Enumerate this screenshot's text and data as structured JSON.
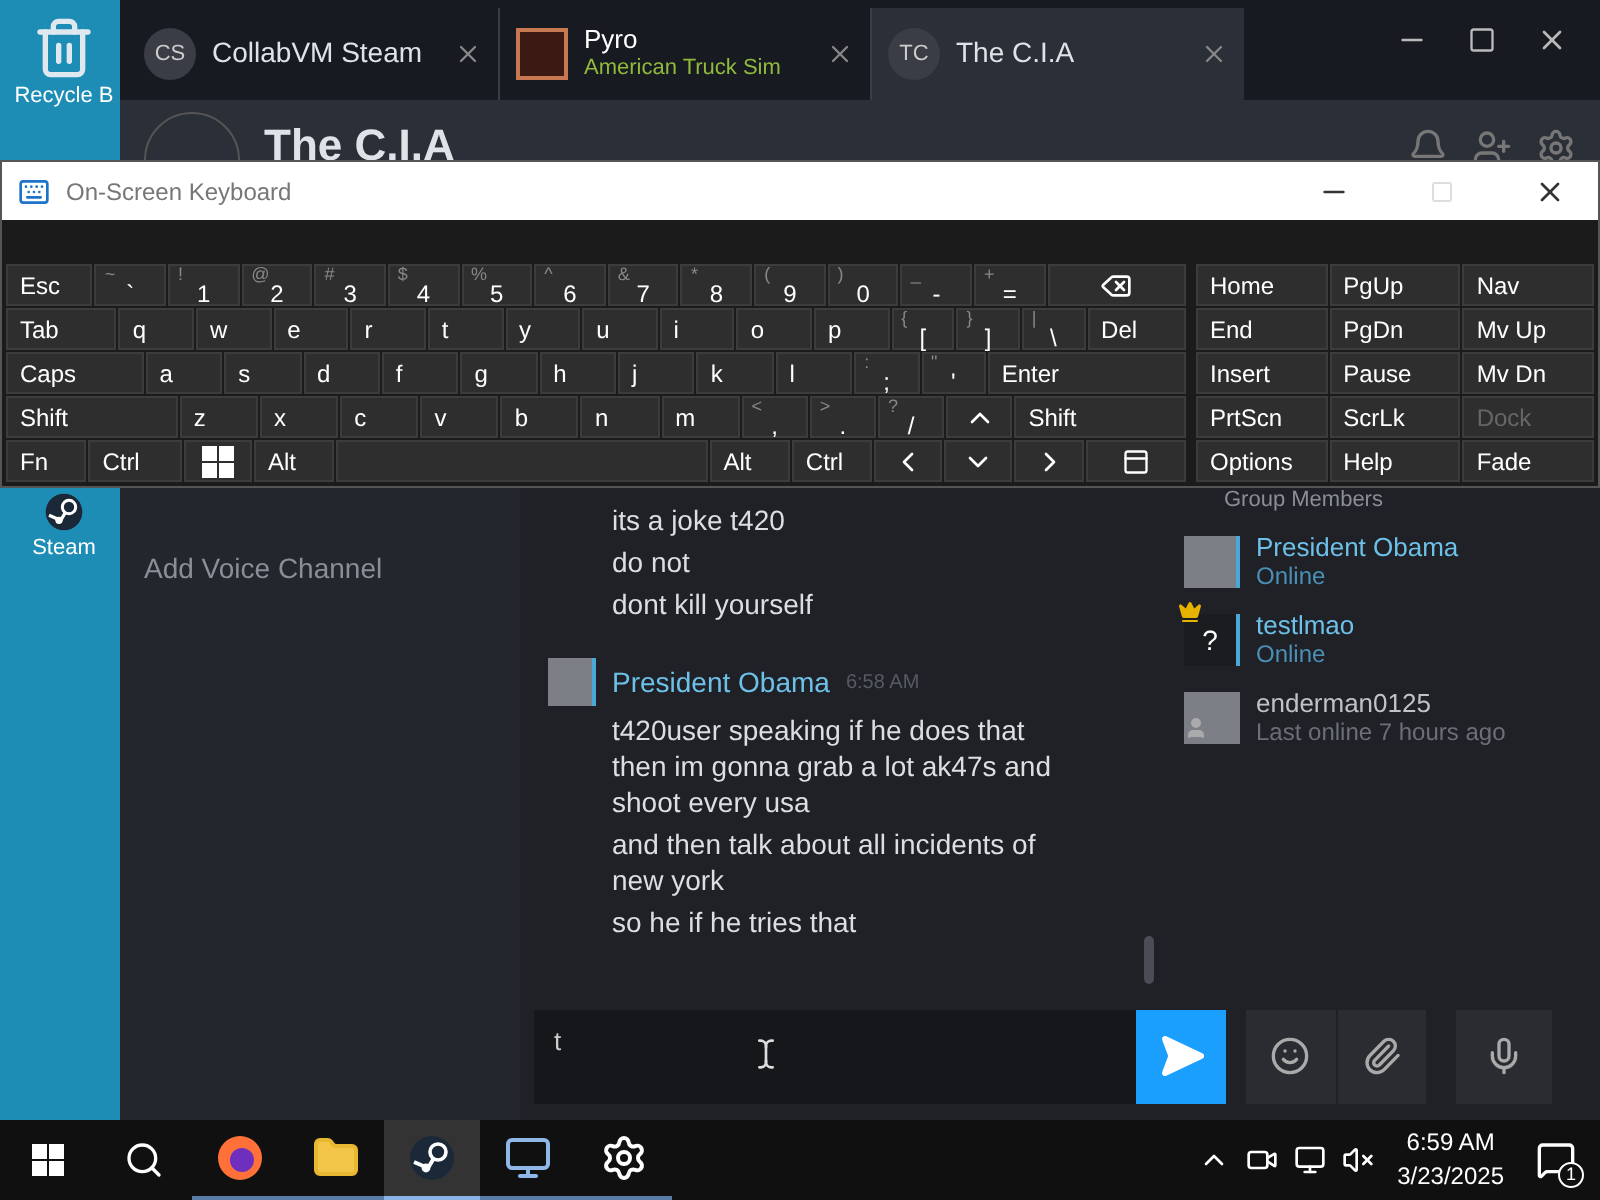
{
  "desktop_icons": [
    {
      "kind": "recycle",
      "label": "Recycle B"
    },
    {
      "kind": "steam",
      "label": "Steam"
    }
  ],
  "steam": {
    "tabs": [
      {
        "kind": "initials",
        "avatar": "CS",
        "title": "CollabVM Steam",
        "selected": false
      },
      {
        "kind": "game",
        "title": "Pyro",
        "subtitle": "American Truck Sim",
        "selected": false
      },
      {
        "kind": "initials",
        "avatar": "TC",
        "title": "The C.I.A",
        "selected": true
      }
    ],
    "group": {
      "name": "The C.I.A"
    },
    "sidebar": {
      "add_voice": "Add Voice Channel"
    },
    "chat": {
      "groups": [
        {
          "messages": [
            "its a joke t420",
            "do not",
            "dont kill yourself"
          ]
        },
        {
          "author": "President Obama",
          "time": "6:58 AM",
          "messages": [
            "t420user speaking if he does that then im gonna grab a lot ak47s and shoot every usa",
            "and then talk about all incidents of new york",
            "so he if he tries that"
          ]
        }
      ]
    },
    "members": {
      "title": "Group Members",
      "list": [
        {
          "name": "President Obama",
          "status": "Online",
          "online": true,
          "owner": false,
          "kind": "photo"
        },
        {
          "name": "testlmao",
          "status": "Online",
          "online": true,
          "owner": true,
          "kind": "unknown",
          "avatar_text": "?"
        },
        {
          "name": "enderman0125",
          "status": "Last online 7 hours ago",
          "online": false,
          "owner": false,
          "kind": "photo"
        }
      ]
    },
    "input": {
      "value": "t"
    }
  },
  "osk": {
    "title": "On-Screen Keyboard",
    "rows": [
      {
        "keys": [
          {
            "kind": "key",
            "label": "Esc"
          },
          {
            "kind": "key",
            "label": "`",
            "shift": "~"
          },
          {
            "kind": "key",
            "label": "1",
            "shift": "!"
          },
          {
            "kind": "key",
            "label": "2",
            "shift": "@"
          },
          {
            "kind": "key",
            "label": "3",
            "shift": "#"
          },
          {
            "kind": "key",
            "label": "4",
            "shift": "$"
          },
          {
            "kind": "key",
            "label": "5",
            "shift": "%"
          },
          {
            "kind": "key",
            "label": "6",
            "shift": "^"
          },
          {
            "kind": "key",
            "label": "7",
            "shift": "&"
          },
          {
            "kind": "key",
            "label": "8",
            "shift": "*"
          },
          {
            "kind": "key",
            "label": "9",
            "shift": "("
          },
          {
            "kind": "key",
            "label": "0",
            "shift": ")"
          },
          {
            "kind": "key",
            "label": "-",
            "shift": "_"
          },
          {
            "kind": "key",
            "label": "=",
            "shift": "+"
          },
          {
            "kind": "backspace"
          }
        ]
      },
      {
        "keys": [
          {
            "kind": "key",
            "label": "Tab"
          },
          {
            "kind": "key",
            "label": "q"
          },
          {
            "kind": "key",
            "label": "w"
          },
          {
            "kind": "key",
            "label": "e"
          },
          {
            "kind": "key",
            "label": "r"
          },
          {
            "kind": "key",
            "label": "t"
          },
          {
            "kind": "key",
            "label": "y"
          },
          {
            "kind": "key",
            "label": "u"
          },
          {
            "kind": "key",
            "label": "i"
          },
          {
            "kind": "key",
            "label": "o"
          },
          {
            "kind": "key",
            "label": "p"
          },
          {
            "kind": "key",
            "label": "[",
            "shift": "{"
          },
          {
            "kind": "key",
            "label": "]",
            "shift": "}"
          },
          {
            "kind": "key",
            "label": "\\",
            "shift": "|"
          },
          {
            "kind": "key",
            "label": "Del"
          }
        ]
      },
      {
        "keys": [
          {
            "kind": "key",
            "label": "Caps"
          },
          {
            "kind": "key",
            "label": "a"
          },
          {
            "kind": "key",
            "label": "s"
          },
          {
            "kind": "key",
            "label": "d"
          },
          {
            "kind": "key",
            "label": "f"
          },
          {
            "kind": "key",
            "label": "g"
          },
          {
            "kind": "key",
            "label": "h"
          },
          {
            "kind": "key",
            "label": "j"
          },
          {
            "kind": "key",
            "label": "k"
          },
          {
            "kind": "key",
            "label": "l"
          },
          {
            "kind": "key",
            "label": ";",
            "shift": ":"
          },
          {
            "kind": "key",
            "label": "'",
            "shift": "\""
          },
          {
            "kind": "key",
            "label": "Enter"
          }
        ]
      },
      {
        "keys": [
          {
            "kind": "key",
            "label": "Shift"
          },
          {
            "kind": "key",
            "label": "z"
          },
          {
            "kind": "key",
            "label": "x"
          },
          {
            "kind": "key",
            "label": "c"
          },
          {
            "kind": "key",
            "label": "v"
          },
          {
            "kind": "key",
            "label": "b"
          },
          {
            "kind": "key",
            "label": "n"
          },
          {
            "kind": "key",
            "label": "m"
          },
          {
            "kind": "key",
            "label": ",",
            "shift": "<"
          },
          {
            "kind": "key",
            "label": ".",
            "shift": ">"
          },
          {
            "kind": "key",
            "label": "/",
            "shift": "?"
          },
          {
            "kind": "up"
          },
          {
            "kind": "key",
            "label": "Shift"
          }
        ]
      },
      {
        "keys": [
          {
            "kind": "key",
            "label": "Fn"
          },
          {
            "kind": "key",
            "label": "Ctrl"
          },
          {
            "kind": "windows"
          },
          {
            "kind": "key",
            "label": "Alt"
          },
          {
            "kind": "space"
          },
          {
            "kind": "key",
            "label": "Alt"
          },
          {
            "kind": "key",
            "label": "Ctrl"
          },
          {
            "kind": "left"
          },
          {
            "kind": "down"
          },
          {
            "kind": "right"
          },
          {
            "kind": "menu"
          }
        ]
      }
    ],
    "nav": [
      {
        "label": "Home",
        "disabled": false
      },
      {
        "label": "PgUp",
        "disabled": false
      },
      {
        "label": "Nav",
        "disabled": false
      },
      {
        "label": "End",
        "disabled": false
      },
      {
        "label": "PgDn",
        "disabled": false
      },
      {
        "label": "Mv Up",
        "disabled": false
      },
      {
        "label": "Insert",
        "disabled": false
      },
      {
        "label": "Pause",
        "disabled": false
      },
      {
        "label": "Mv Dn",
        "disabled": false
      },
      {
        "label": "PrtScn",
        "disabled": false
      },
      {
        "label": "ScrLk",
        "disabled": false
      },
      {
        "label": "Dock",
        "disabled": true
      },
      {
        "label": "Options",
        "disabled": false
      },
      {
        "label": "Help",
        "disabled": false
      },
      {
        "label": "Fade",
        "disabled": false
      }
    ]
  },
  "taskbar": {
    "apps": [
      {
        "kind": "firefox",
        "selected": false
      },
      {
        "kind": "explorer",
        "selected": false
      },
      {
        "kind": "steam",
        "selected": true
      },
      {
        "kind": "remote",
        "selected": false
      },
      {
        "kind": "settings",
        "selected": false
      }
    ],
    "time": "6:59 AM",
    "date": "3/23/2025",
    "notifications": "1"
  }
}
